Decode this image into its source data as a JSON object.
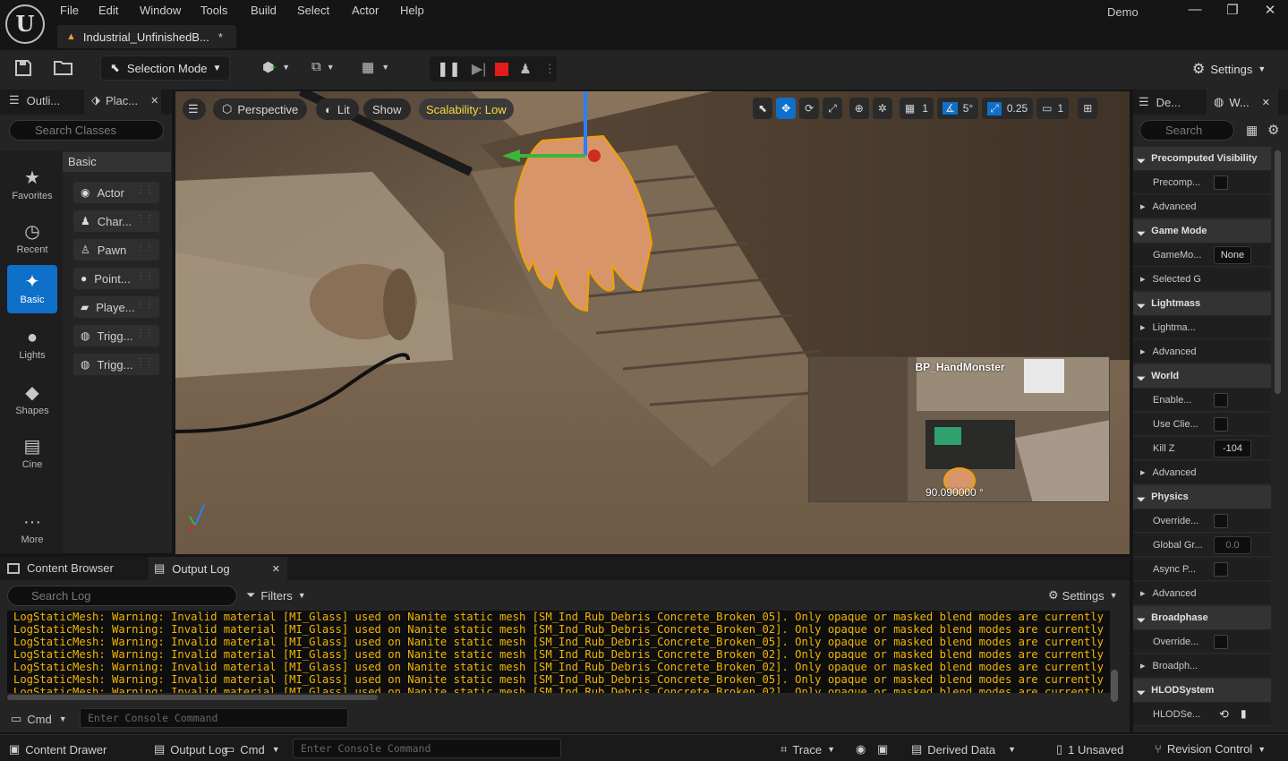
{
  "app": {
    "project_tab": "Industrial_UnfinishedB...",
    "project_tab_modified": "*",
    "window_user": "Demo",
    "logo": "U"
  },
  "menu": [
    "File",
    "Edit",
    "Window",
    "Tools",
    "Build",
    "Select",
    "Actor",
    "Help"
  ],
  "window_controls": {
    "minimize": "—",
    "restore": "❐",
    "close": "✕"
  },
  "toolbar": {
    "save_icon": "save-icon",
    "selection_mode": "Selection Mode",
    "settings": "Settings"
  },
  "left_tabs": {
    "outliner": "Outli...",
    "place": "Plac..."
  },
  "place": {
    "search_placeholder": "Search Classes",
    "categories": [
      {
        "label": "Favorites",
        "icon": "star-icon",
        "glyph": "★"
      },
      {
        "label": "Recent",
        "icon": "clock-icon",
        "glyph": "◷"
      },
      {
        "label": "Basic",
        "icon": "shapes-icon",
        "glyph": "✦",
        "active": true
      },
      {
        "label": "Lights",
        "icon": "bulb-icon",
        "glyph": "●"
      },
      {
        "label": "Shapes",
        "icon": "cube-icon",
        "glyph": "◆"
      },
      {
        "label": "Cine",
        "icon": "clapper-icon",
        "glyph": "▤"
      },
      {
        "label": "More",
        "icon": "more-icon",
        "glyph": "···"
      }
    ],
    "group": "Basic",
    "items": [
      {
        "label": "Actor",
        "glyph": "◉"
      },
      {
        "label": "Char...",
        "glyph": "♟"
      },
      {
        "label": "Pawn",
        "glyph": "♙"
      },
      {
        "label": "Point...",
        "glyph": "●"
      },
      {
        "label": "Playe...",
        "glyph": "▰"
      },
      {
        "label": "Trigg...",
        "glyph": "◍"
      },
      {
        "label": "Trigg...",
        "glyph": "◍"
      }
    ]
  },
  "viewport": {
    "perspective": "Perspective",
    "lit": "Lit",
    "show": "Show",
    "scalability": "Scalability: Low",
    "grid_value": "1",
    "angle_value": "5°",
    "scale_value": "0.25",
    "camera_value": "1",
    "pip_title": "BP_HandMonster",
    "pip_value": "90.090000 °"
  },
  "bottom": {
    "content_browser": "Content Browser",
    "output_log": "Output Log",
    "search_placeholder": "Search Log",
    "filters": "Filters",
    "settings": "Settings",
    "log_lines": [
      "LogStaticMesh: Warning: Invalid material [MI_Glass] used on Nanite static mesh [SM_Ind_Rub_Debris_Concrete_Broken_05]. Only opaque or masked blend modes are currently supporte",
      "LogStaticMesh: Warning: Invalid material [MI_Glass] used on Nanite static mesh [SM_Ind_Rub_Debris_Concrete_Broken_02]. Only opaque or masked blend modes are currently supporte",
      "LogStaticMesh: Warning: Invalid material [MI_Glass] used on Nanite static mesh [SM_Ind_Rub_Debris_Concrete_Broken_05]. Only opaque or masked blend modes are currently supporte",
      "LogStaticMesh: Warning: Invalid material [MI_Glass] used on Nanite static mesh [SM_Ind_Rub_Debris_Concrete_Broken_02]. Only opaque or masked blend modes are currently supporte",
      "LogStaticMesh: Warning: Invalid material [MI_Glass] used on Nanite static mesh [SM_Ind_Rub_Debris_Concrete_Broken_02]. Only opaque or masked blend modes are currently supporte",
      "LogStaticMesh: Warning: Invalid material [MI_Glass] used on Nanite static mesh [SM_Ind_Rub_Debris_Concrete_Broken_05]. Only opaque or masked blend modes are currently supporte",
      "LogStaticMesh: Warning: Invalid material [MI_Glass] used on Nanite static mesh [SM_Ind_Rub_Debris_Concrete_Broken_02]. Only opaque or masked blend modes are currently supporte"
    ],
    "cmd": "Cmd",
    "console_placeholder": "Enter Console Command"
  },
  "status": {
    "content_drawer": "Content Drawer",
    "output_log": "Output Log",
    "cmd": "Cmd",
    "console_placeholder": "Enter Console Command",
    "trace": "Trace",
    "derived_data": "Derived Data",
    "unsaved": "1 Unsaved",
    "revision_control": "Revision Control"
  },
  "right": {
    "tab_details": "De...",
    "tab_world": "W...",
    "search_placeholder": "Search",
    "sections": [
      {
        "title": "Precomputed Visibility",
        "props": [
          {
            "label": "Precomp...",
            "type": "check"
          },
          {
            "label": "Advanced",
            "type": "adv"
          }
        ]
      },
      {
        "title": "Game Mode",
        "props": [
          {
            "label": "GameMo...",
            "type": "value",
            "value": "None"
          },
          {
            "label": "Selected G",
            "type": "adv"
          }
        ]
      },
      {
        "title": "Lightmass",
        "props": [
          {
            "label": "Lightma...",
            "type": "adv"
          },
          {
            "label": "Advanced",
            "type": "adv"
          }
        ]
      },
      {
        "title": "World",
        "props": [
          {
            "label": "Enable...",
            "type": "check"
          },
          {
            "label": "Use Clie...",
            "type": "check"
          },
          {
            "label": "Kill Z",
            "type": "value",
            "value": "-104"
          },
          {
            "label": "Advanced",
            "type": "adv"
          }
        ]
      },
      {
        "title": "Physics",
        "props": [
          {
            "label": "Override...",
            "type": "check"
          },
          {
            "label": "Global Gr...",
            "type": "value",
            "value": "0.0",
            "dim": true
          },
          {
            "label": "Async P...",
            "type": "check"
          },
          {
            "label": "Advanced",
            "type": "adv"
          }
        ]
      },
      {
        "title": "Broadphase",
        "props": [
          {
            "label": "Override...",
            "type": "check"
          },
          {
            "label": "Broadph...",
            "type": "adv"
          }
        ]
      },
      {
        "title": "HLODSystem",
        "props": [
          {
            "label": "HLODSe...",
            "type": "icons"
          }
        ]
      }
    ]
  }
}
